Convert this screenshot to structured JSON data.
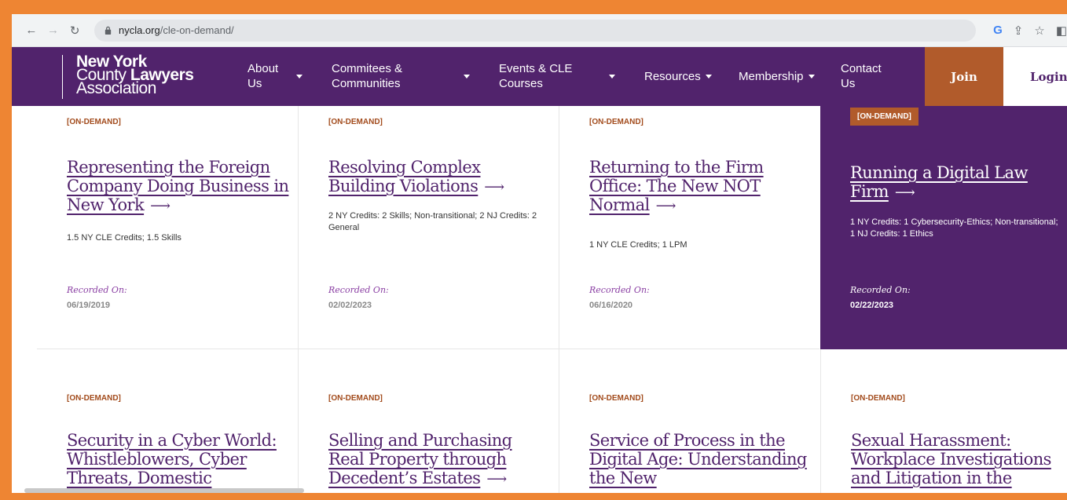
{
  "browser": {
    "url_host": "nycla.org",
    "url_path": "/cle-on-demand/"
  },
  "site": {
    "logo": {
      "line1": "New York",
      "line2_a": "County ",
      "line2_b": "Lawyers",
      "line3": "Association"
    },
    "nav": [
      {
        "label": "About Us"
      },
      {
        "label": "Commitees & Communities"
      },
      {
        "label": "Events & CLE Courses"
      },
      {
        "label": "Resources"
      },
      {
        "label": "Membership"
      },
      {
        "label": "Contact Us"
      }
    ],
    "join_label": "Join",
    "login_label": "Login"
  },
  "cards": [
    {
      "tag": "[ON-DEMAND]",
      "title": "Representing the Foreign Company Doing Business in New York",
      "credits": "1.5 NY CLE Credits; 1.5 Skills",
      "recorded_label": "Recorded On:",
      "recorded_date": "06/19/2019"
    },
    {
      "tag": "[ON-DEMAND]",
      "title": "Resolving Complex Building Violations",
      "credits": "2 NY Credits: 2 Skills; Non-transitional; 2 NJ Credits: 2 General",
      "recorded_label": "Recorded On:",
      "recorded_date": "02/02/2023"
    },
    {
      "tag": "[ON-DEMAND]",
      "title": "Returning to the Firm Office: The New NOT Normal",
      "credits": "1 NY CLE Credits; 1 LPM",
      "recorded_label": "Recorded On:",
      "recorded_date": "06/16/2020"
    },
    {
      "tag": "[ON-DEMAND]",
      "title": "Running a Digital Law Firm",
      "credits": "1 NY Credits: 1 Cybersecurity-Ethics; Non-transitional; 1 NJ Credits: 1 Ethics",
      "recorded_label": "Recorded On:",
      "recorded_date": "02/22/2023"
    },
    {
      "tag": "[ON-DEMAND]",
      "title": "Security in a Cyber World: Whistleblowers, Cyber Threats, Domestic",
      "credits": "",
      "recorded_label": "",
      "recorded_date": ""
    },
    {
      "tag": "[ON-DEMAND]",
      "title": "Selling and Purchasing Real Property through Decedent’s Estates",
      "credits": "",
      "recorded_label": "",
      "recorded_date": ""
    },
    {
      "tag": "[ON-DEMAND]",
      "title": "Service of Process in the Digital Age: Understanding the New",
      "credits": "",
      "recorded_label": "",
      "recorded_date": ""
    },
    {
      "tag": "[ON-DEMAND]",
      "title": "Sexual Harassment: Workplace Investigations and Litigation in the",
      "credits": "",
      "recorded_label": "",
      "recorded_date": ""
    }
  ],
  "arrow_glyph": "⟶",
  "colors": {
    "brand_purple": "#51236c",
    "brand_orange": "#b15b2b",
    "tag_orange": "#a24b1c",
    "frame": "#ee8533"
  }
}
